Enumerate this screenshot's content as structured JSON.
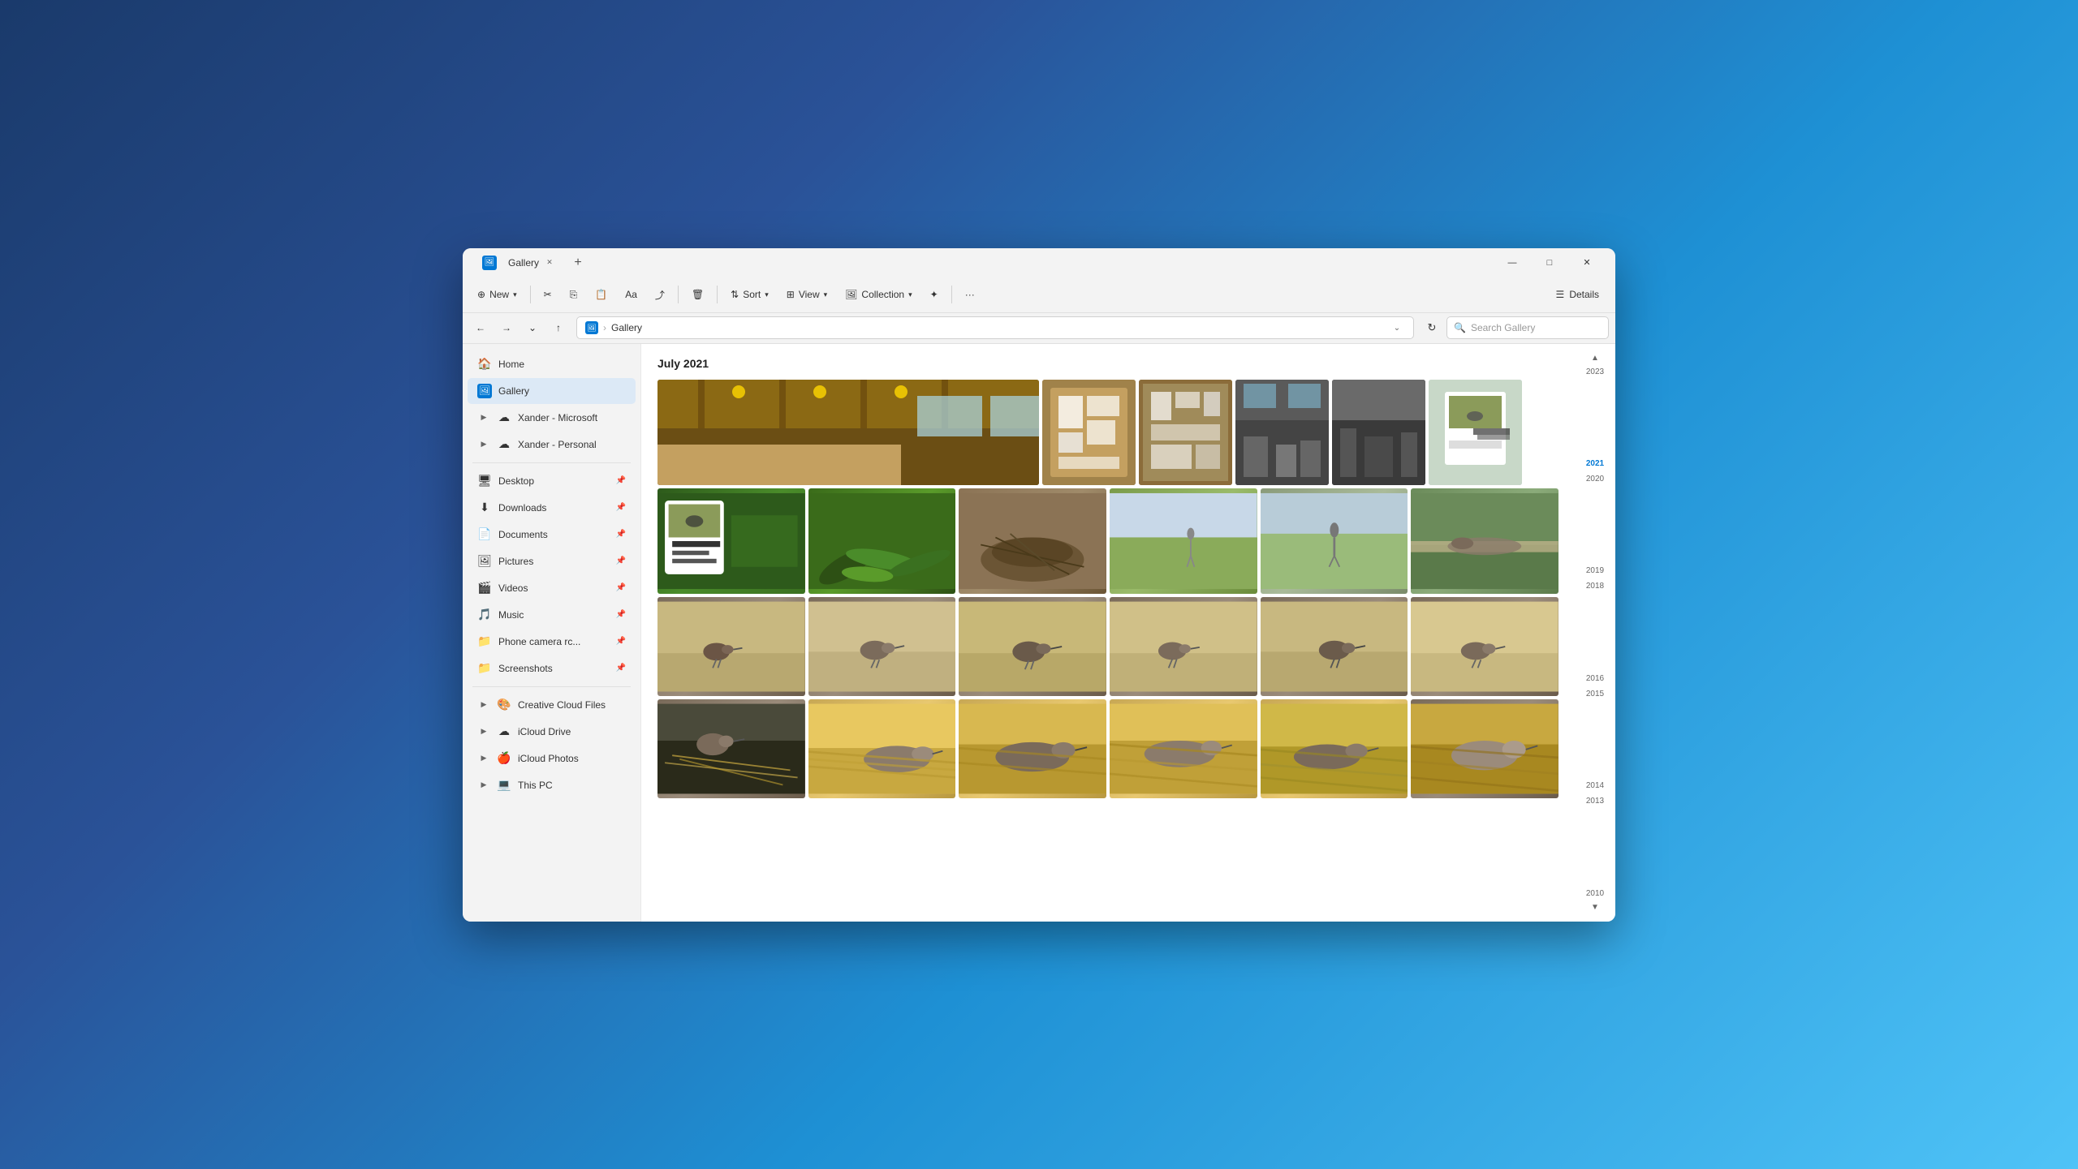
{
  "window": {
    "title": "Gallery",
    "tab_label": "Gallery",
    "close_label": "✕",
    "minimize_label": "—",
    "maximize_label": "□",
    "new_tab_label": "+"
  },
  "toolbar": {
    "new_label": "New",
    "cut_label": "✂",
    "copy_label": "⧉",
    "paste_label": "📋",
    "rename_label": "✏",
    "share_label": "⤴",
    "delete_label": "🗑",
    "sort_label": "Sort",
    "view_label": "View",
    "collection_label": "Collection",
    "ai_label": "✦",
    "more_label": "···",
    "details_label": "Details"
  },
  "nav": {
    "back_label": "←",
    "forward_label": "→",
    "recent_label": "⌄",
    "up_label": "↑",
    "breadcrumb_home": "Gallery",
    "chevron_label": "›",
    "refresh_label": "↻",
    "search_placeholder": "Search Gallery",
    "search_icon": "🔍"
  },
  "sidebar": {
    "home_label": "Home",
    "gallery_label": "Gallery",
    "xander_microsoft_label": "Xander - Microsoft",
    "xander_personal_label": "Xander - Personal",
    "desktop_label": "Desktop",
    "downloads_label": "Downloads",
    "documents_label": "Documents",
    "pictures_label": "Pictures",
    "videos_label": "Videos",
    "music_label": "Music",
    "phone_camera_label": "Phone camera rc...",
    "screenshots_label": "Screenshots",
    "creative_cloud_label": "Creative Cloud Files",
    "icloud_drive_label": "iCloud Drive",
    "icloud_photos_label": "iCloud Photos",
    "this_pc_label": "This PC"
  },
  "gallery": {
    "section_title": "July 2021"
  },
  "timeline": {
    "years": [
      "2023",
      "2021",
      "2020",
      "2019",
      "2018",
      "2016",
      "2015",
      "2014",
      "2013",
      "2010"
    ],
    "active_year": "2021",
    "up_arrow": "▲",
    "down_arrow": "▼"
  }
}
